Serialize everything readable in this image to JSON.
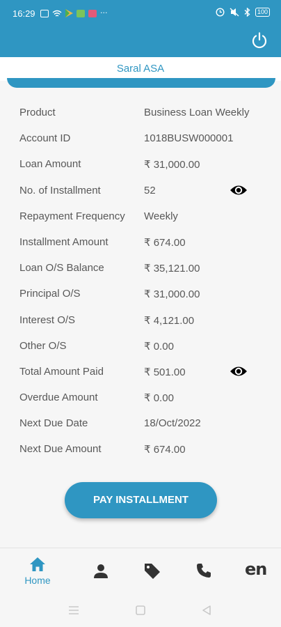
{
  "status_bar": {
    "time": "16:29",
    "battery": "100",
    "left_icons": [
      "message-icon",
      "wifi-call-icon",
      "play-store-icon",
      "app-icon",
      "app-icon",
      "more-dots-icon"
    ],
    "right_icons": [
      "alarm-icon",
      "mute-icon",
      "bluetooth-icon",
      "battery-icon"
    ]
  },
  "header": {
    "title": "Saral ASA",
    "power_icon": "power-icon",
    "accent": "#2f96c2"
  },
  "details": [
    {
      "label": "Product",
      "value": "Business Loan Weekly"
    },
    {
      "label": "Account ID",
      "value": "1018BUSW000001"
    },
    {
      "label": "Loan Amount",
      "value": "₹ 31,000.00"
    },
    {
      "label": "No. of Installment",
      "value": "52",
      "icon": "eye-icon"
    },
    {
      "label": "Repayment Frequency",
      "value": "Weekly"
    },
    {
      "label": "Installment Amount",
      "value": "₹ 674.00"
    },
    {
      "label": "Loan O/S Balance",
      "value": "₹ 35,121.00"
    },
    {
      "label": "Principal O/S",
      "value": "₹ 31,000.00"
    },
    {
      "label": "Interest O/S",
      "value": "₹ 4,121.00"
    },
    {
      "label": "Other O/S",
      "value": "₹ 0.00"
    },
    {
      "label": "Total Amount Paid",
      "value": "₹ 501.00",
      "icon": "eye-icon"
    },
    {
      "label": "Overdue Amount",
      "value": "₹ 0.00"
    },
    {
      "label": "Next Due Date",
      "value": "18/Oct/2022"
    },
    {
      "label": "Next Due Amount",
      "value": "₹ 674.00"
    }
  ],
  "pay_button": {
    "label": "PAY INSTALLMENT"
  },
  "bottom_nav": {
    "home_label": "Home",
    "lang_label": "en",
    "items": [
      "home-icon",
      "person-icon",
      "tag-icon",
      "phone-icon",
      "language-icon"
    ]
  }
}
